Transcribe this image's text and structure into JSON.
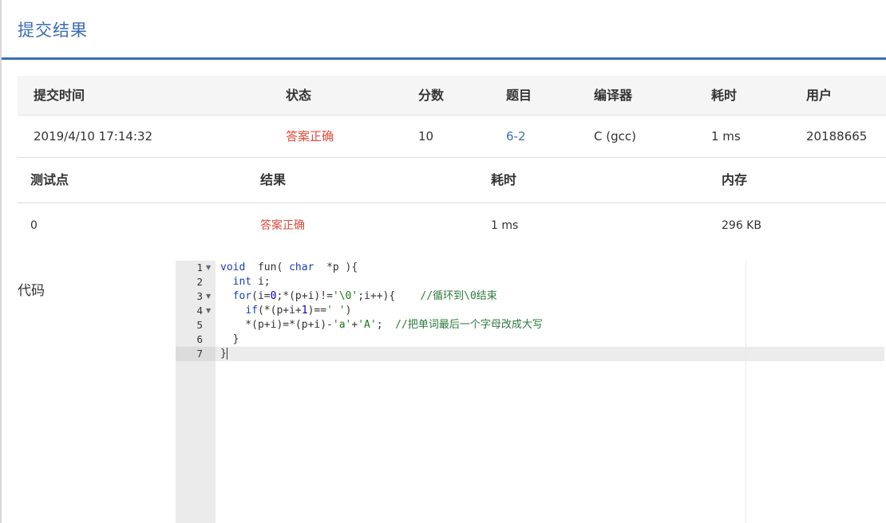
{
  "modal": {
    "title": "提交结果"
  },
  "summary": {
    "headers": [
      "提交时间",
      "状态",
      "分数",
      "题目",
      "编译器",
      "耗时",
      "用户"
    ],
    "row": {
      "time": "2019/4/10 17:14:32",
      "status": "答案正确",
      "score": "10",
      "problem": "6-2",
      "compiler": "C (gcc)",
      "elapsed": "1 ms",
      "user": "20188665"
    }
  },
  "cases": {
    "headers": [
      "测试点",
      "结果",
      "耗时",
      "内存"
    ],
    "rows": [
      {
        "id": "0",
        "result": "答案正确",
        "time": "1 ms",
        "memory": "296 KB"
      }
    ]
  },
  "code": {
    "label": "代码",
    "line_numbers": [
      "1",
      "2",
      "3",
      "4",
      "5",
      "6",
      "7"
    ],
    "lines": [
      {
        "segments": [
          [
            "kw",
            "void"
          ],
          [
            "",
            "  fun( "
          ],
          [
            "kw",
            "char"
          ],
          [
            "",
            "  *p )"
          ],
          [
            "",
            "{"
          ]
        ]
      },
      {
        "segments": [
          [
            "",
            "  "
          ],
          [
            "kw",
            "int"
          ],
          [
            "",
            " i;"
          ]
        ]
      },
      {
        "segments": [
          [
            "",
            "  "
          ],
          [
            "kw",
            "for"
          ],
          [
            "",
            "(i="
          ],
          [
            "num",
            "0"
          ],
          [
            "",
            ";*(p+i)!="
          ],
          [
            "str",
            "'\\0'"
          ],
          [
            "",
            ";i++){    "
          ],
          [
            "cm",
            "//循环到\\0结束"
          ]
        ]
      },
      {
        "segments": [
          [
            "",
            "    "
          ],
          [
            "kw",
            "if"
          ],
          [
            "",
            "(*(p+i+"
          ],
          [
            "num",
            "1"
          ],
          [
            "",
            ")=="
          ],
          [
            "str",
            "' '"
          ],
          [
            "",
            ")"
          ]
        ]
      },
      {
        "segments": [
          [
            "",
            "    *(p+i)=*(p+i)-"
          ],
          [
            "str",
            "'a'"
          ],
          [
            "",
            "+"
          ],
          [
            "str",
            "'A'"
          ],
          [
            "",
            ";  "
          ],
          [
            "cm",
            "//把单词最后一个字母改成大写"
          ]
        ]
      },
      {
        "segments": [
          [
            "",
            "  }"
          ]
        ]
      },
      {
        "segments": [
          [
            "",
            "}"
          ]
        ]
      }
    ]
  }
}
